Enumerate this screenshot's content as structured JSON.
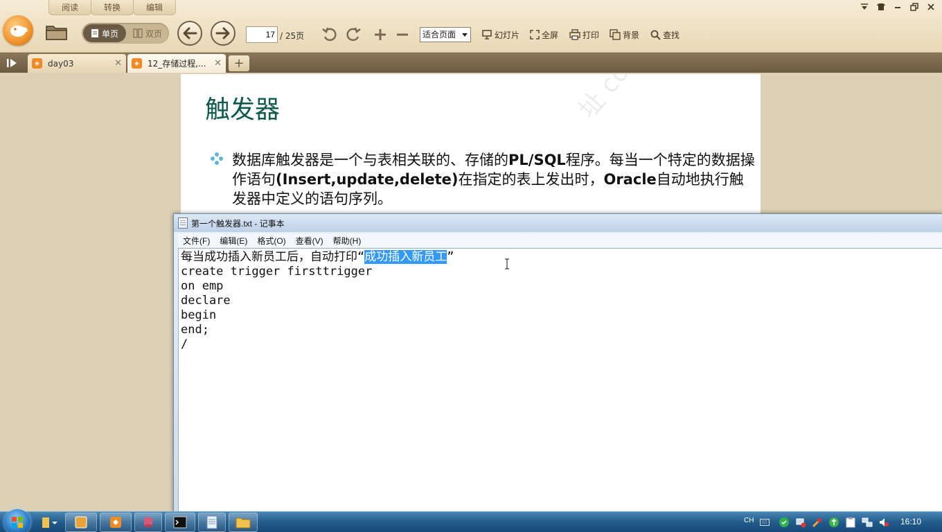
{
  "reader": {
    "mode_tabs": [
      "阅读",
      "转换",
      "编辑"
    ],
    "view_modes": {
      "single": "单页",
      "double": "双页"
    },
    "page": {
      "current": "17",
      "total": "/ 25页"
    },
    "zoom": "适合页面",
    "tools": {
      "slideshow": "幻灯片",
      "fullscreen": "全屏",
      "print": "打印",
      "background": "背景",
      "find": "查找"
    }
  },
  "tabs": [
    {
      "title": "day03"
    },
    {
      "title": "12_存储过程,..."
    }
  ],
  "slide": {
    "title": "触发器",
    "bullet_parts": [
      "数据库触发器是一个与表相关联的、存储的",
      "PL/SQL",
      "程序。每当一个特定的数据操作语句",
      "(Insert,update,delete)",
      "在指定的表上发出时，",
      "Oracle",
      "自动地执行触发器中定义的语句序列。"
    ]
  },
  "notepad": {
    "title": "第一个触发器.txt - 记事本",
    "menu": [
      "文件(F)",
      "编辑(E)",
      "格式(O)",
      "查看(V)",
      "帮助(H)"
    ],
    "line1_prefix": "每当成功插入新员工后，自动打印“",
    "line1_selected": "成功插入新员工",
    "line1_suffix": "”",
    "code_lines": [
      "",
      "create trigger firsttrigger",
      "",
      "on emp",
      "declare",
      "begin",
      "",
      "end;",
      "/"
    ]
  },
  "taskbar": {
    "lang": "CH",
    "clock": "16:10"
  }
}
